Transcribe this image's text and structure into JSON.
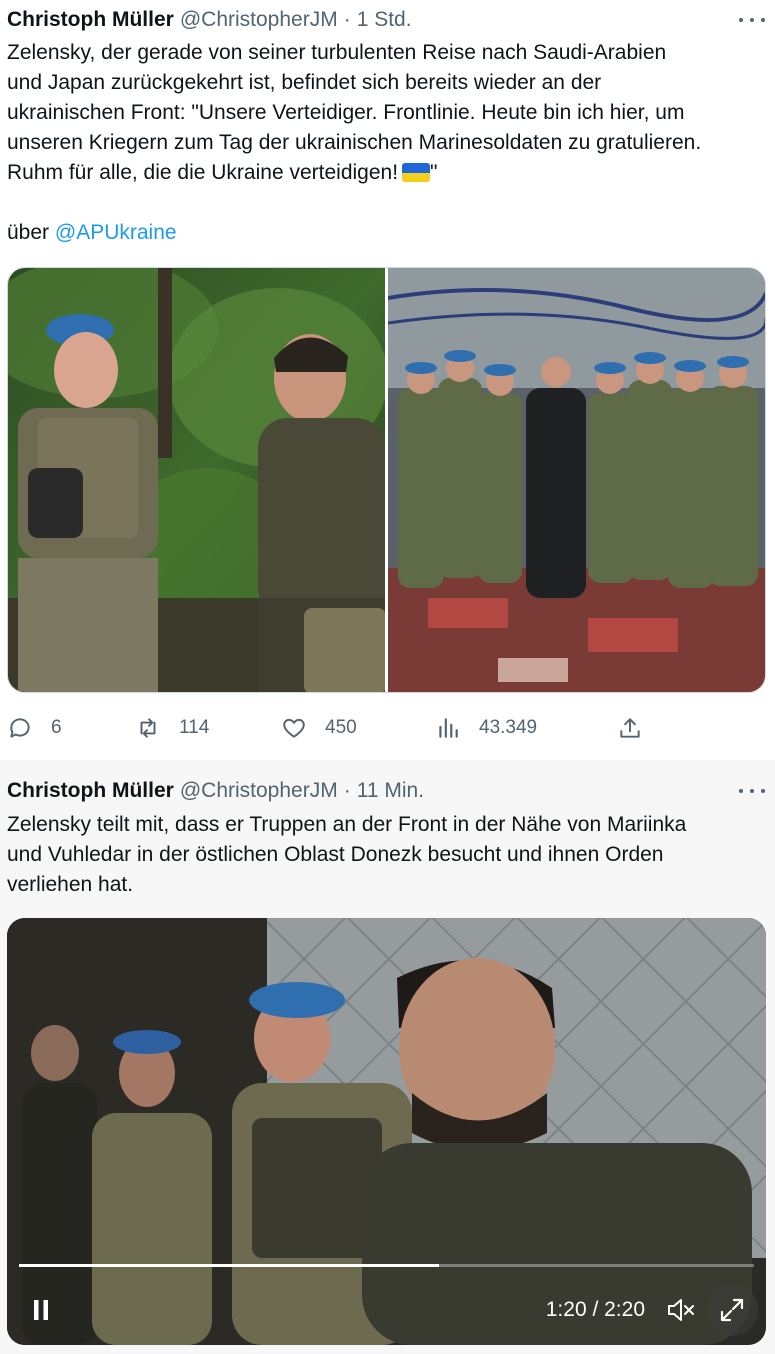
{
  "tweets": [
    {
      "author_name": "Christoph Müller",
      "handle": "@ChristopherJM",
      "separator": "·",
      "time": "1 Std.",
      "text_lines": [
        "Zelensky, der gerade von seiner turbulenten Reise nach Saudi-Arabien",
        "und Japan zurückgekehrt ist, befindet sich bereits wieder an der",
        "ukrainischen Front: \"Unsere Verteidiger. Frontlinie. Heute bin ich hier, um",
        "unseren Kriegern zum Tag der ukrainischen Marinesoldaten zu gratulieren.",
        "Ruhm für alle, die die Ukraine verteidigen!",
        "\""
      ],
      "via_text": "über",
      "via_mention": "@APUkraine",
      "photos": [
        {
          "icon": "photo-officer-and-zelensky-forest"
        },
        {
          "icon": "photo-group-soldiers-indoor"
        }
      ],
      "actions": {
        "replies": "6",
        "reposts": "114",
        "likes": "450",
        "views": "43.349"
      }
    },
    {
      "author_name": "Christoph Müller",
      "handle": "@ChristopherJM",
      "separator": "·",
      "time": "11 Min.",
      "text_lines": [
        "Zelensky teilt mit, dass er Truppen an der Front in der Nähe von Mariinka",
        "und Vuhledar in der östlichen Oblast Donezk besucht und ihnen Orden",
        "verliehen hat."
      ],
      "video": {
        "time_display": "1:20 / 2:20",
        "progress": 0.5714,
        "state": "playing",
        "muted": true
      }
    }
  ],
  "colors": {
    "link": "#1d9bf0",
    "secondary_text": "#536471",
    "flag_blue": "#1f67d6",
    "flag_yellow": "#f5cf1d"
  }
}
